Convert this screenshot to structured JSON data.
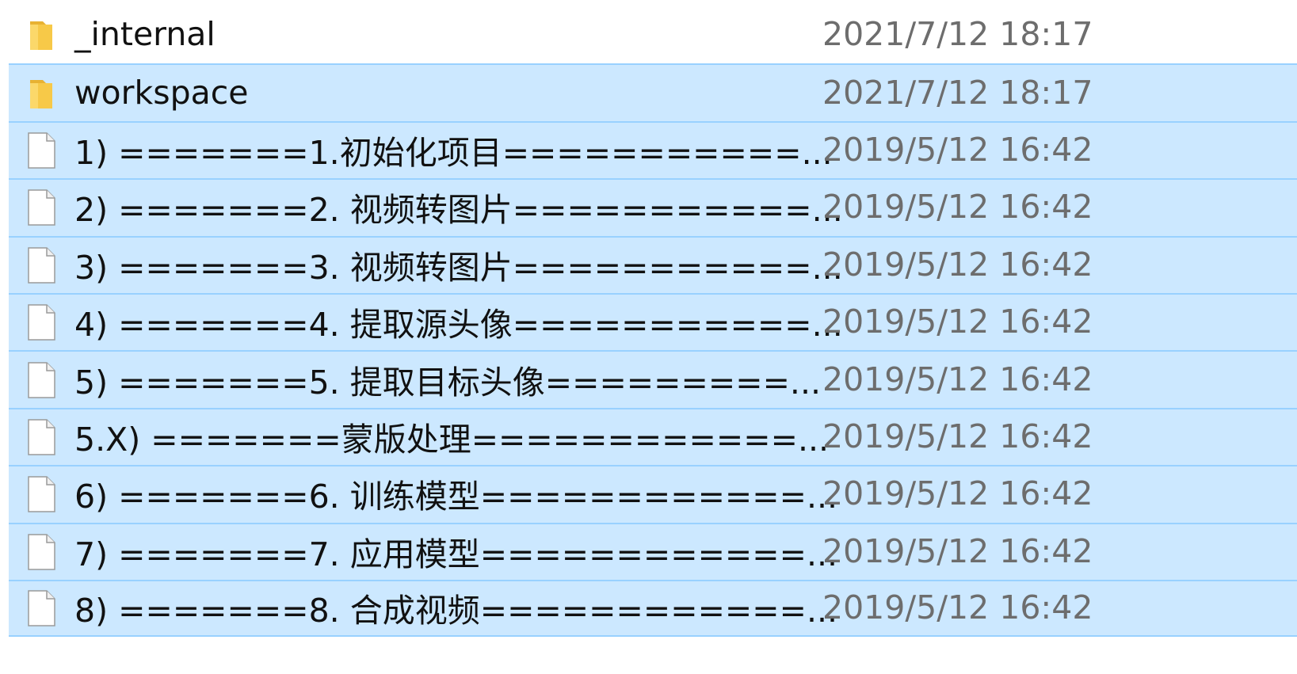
{
  "colors": {
    "selection_bg": "#cce8ff",
    "selection_border": "#99d1ff",
    "folder_yellow": "#f7c948",
    "text": "#111111",
    "date_text": "#6d6d6d"
  },
  "items": [
    {
      "name": "_internal",
      "date": "2021/7/12 18:17",
      "icon": "folder-icon",
      "selected": false
    },
    {
      "name": "workspace",
      "date": "2021/7/12 18:17",
      "icon": "folder-icon",
      "selected": true
    },
    {
      "name": "1) =======1.初始化项目===========...",
      "date": "2019/5/12 16:42",
      "icon": "file-icon",
      "selected": true
    },
    {
      "name": "2) =======2. 视频转图片===========...",
      "date": "2019/5/12 16:42",
      "icon": "file-icon",
      "selected": true
    },
    {
      "name": "3) =======3. 视频转图片===========...",
      "date": "2019/5/12 16:42",
      "icon": "file-icon",
      "selected": true
    },
    {
      "name": "4) =======4. 提取源头像===========...",
      "date": "2019/5/12 16:42",
      "icon": "file-icon",
      "selected": true
    },
    {
      "name": "5) =======5. 提取目标头像=========...",
      "date": "2019/5/12 16:42",
      "icon": "file-icon",
      "selected": true
    },
    {
      "name": "5.X) =======蒙版处理============...",
      "date": "2019/5/12 16:42",
      "icon": "file-icon",
      "selected": true
    },
    {
      "name": "6) =======6. 训练模型============...",
      "date": "2019/5/12 16:42",
      "icon": "file-icon",
      "selected": true
    },
    {
      "name": "7) =======7. 应用模型============...",
      "date": "2019/5/12 16:42",
      "icon": "file-icon",
      "selected": true
    },
    {
      "name": "8) =======8. 合成视频============...",
      "date": "2019/5/12 16:42",
      "icon": "file-icon",
      "selected": true
    }
  ]
}
